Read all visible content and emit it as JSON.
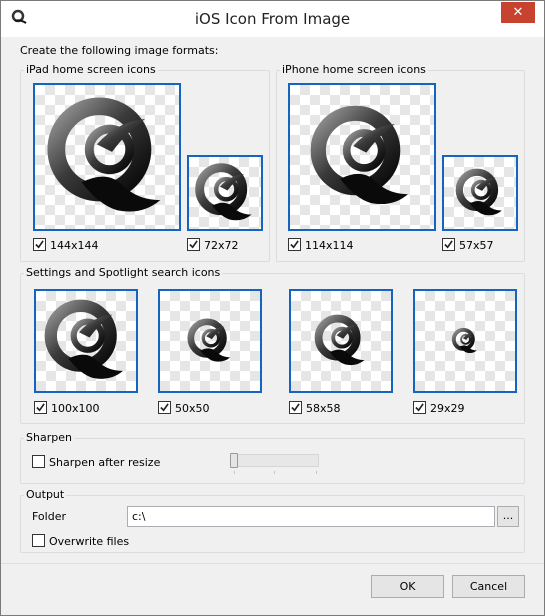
{
  "window": {
    "title": "iOS Icon From Image",
    "close_glyph": "✕"
  },
  "intro_text": "Create the following image formats:",
  "ipad": {
    "label": "iPad home screen icons",
    "icons": [
      {
        "size_label": "144x144",
        "checked": true
      },
      {
        "size_label": "72x72",
        "checked": true
      }
    ]
  },
  "iphone": {
    "label": "iPhone home screen icons",
    "icons": [
      {
        "size_label": "114x114",
        "checked": true
      },
      {
        "size_label": "57x57",
        "checked": true
      }
    ]
  },
  "settings": {
    "label": "Settings and Spotlight search icons",
    "icons": [
      {
        "size_label": "100x100",
        "checked": true
      },
      {
        "size_label": "50x50",
        "checked": true
      },
      {
        "size_label": "58x58",
        "checked": true
      },
      {
        "size_label": "29x29",
        "checked": true
      }
    ]
  },
  "sharpen": {
    "label": "Sharpen",
    "checkbox_label": "Sharpen after resize",
    "checked": false,
    "slider_level": 0
  },
  "output": {
    "label": "Output",
    "folder_label": "Folder",
    "folder_value": "c:\\",
    "browse_label": "...",
    "overwrite_label": "Overwrite files",
    "overwrite_checked": false
  },
  "buttons": {
    "ok": "OK",
    "cancel": "Cancel"
  },
  "colors": {
    "selection_border": "#1565c0",
    "close_button": "#c7432f"
  }
}
